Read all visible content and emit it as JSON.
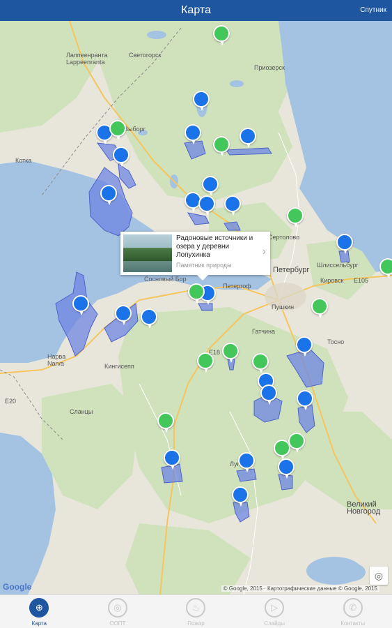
{
  "header": {
    "title": "Карта",
    "satellite_label": "Спутник"
  },
  "map": {
    "labels": {
      "lappeenranta": "Лаппеенранта\nLappeenranta",
      "svetogorsk": "Светогорск",
      "vyborg": "Выборг",
      "priozersk": "Приозерск",
      "sosnovy_bor": "Сосновый Бор",
      "peterburg": "Петербург",
      "petergof": "Петергоф",
      "pushkin": "Пушкин",
      "gatchina": "Гатчина",
      "kirovsk": "Кировск",
      "narva": "Нарва\nNarva",
      "kingisepp": "Кингисепп",
      "slantsy": "Сланцы",
      "luga": "Луга",
      "tosno": "Тосно",
      "shlisselburg": "Шлиссельбург",
      "sertolovo": "Сертолово",
      "veliky_novgorod": "Великий\nНовгород",
      "kotka": "Котка",
      "road_e20": "E20",
      "road_e105": "E105",
      "road_e18": "E18"
    },
    "attribution": "© Google, 2015 · Картографические данные © Google, 2015",
    "google_logo": "Google",
    "location_icon": "target-icon"
  },
  "info_window": {
    "title": "Радоновые источники и озера у деревни Лопухинка",
    "subtitle": "Памятник природы",
    "chevron": "›"
  },
  "markers": {
    "blue_count": 26,
    "green_count": 17
  },
  "tabs": [
    {
      "label": "Карта",
      "icon": "map-pin-icon",
      "glyph": "⊕",
      "active": true
    },
    {
      "label": "ООПТ",
      "icon": "globe-icon",
      "glyph": "◎",
      "active": false
    },
    {
      "label": "Пожар",
      "icon": "fire-icon",
      "glyph": "♨",
      "active": false
    },
    {
      "label": "Слайды",
      "icon": "play-icon",
      "glyph": "▷",
      "active": false
    },
    {
      "label": "Контакты",
      "icon": "phone-icon",
      "glyph": "✆",
      "active": false
    }
  ],
  "colors": {
    "header": "#1e56a0",
    "marker_blue": "#1a73e8",
    "marker_green": "#43c75b",
    "water": "#a4c3e3",
    "forest": "#c9dfb5",
    "area_fill": "#6f86e3"
  }
}
